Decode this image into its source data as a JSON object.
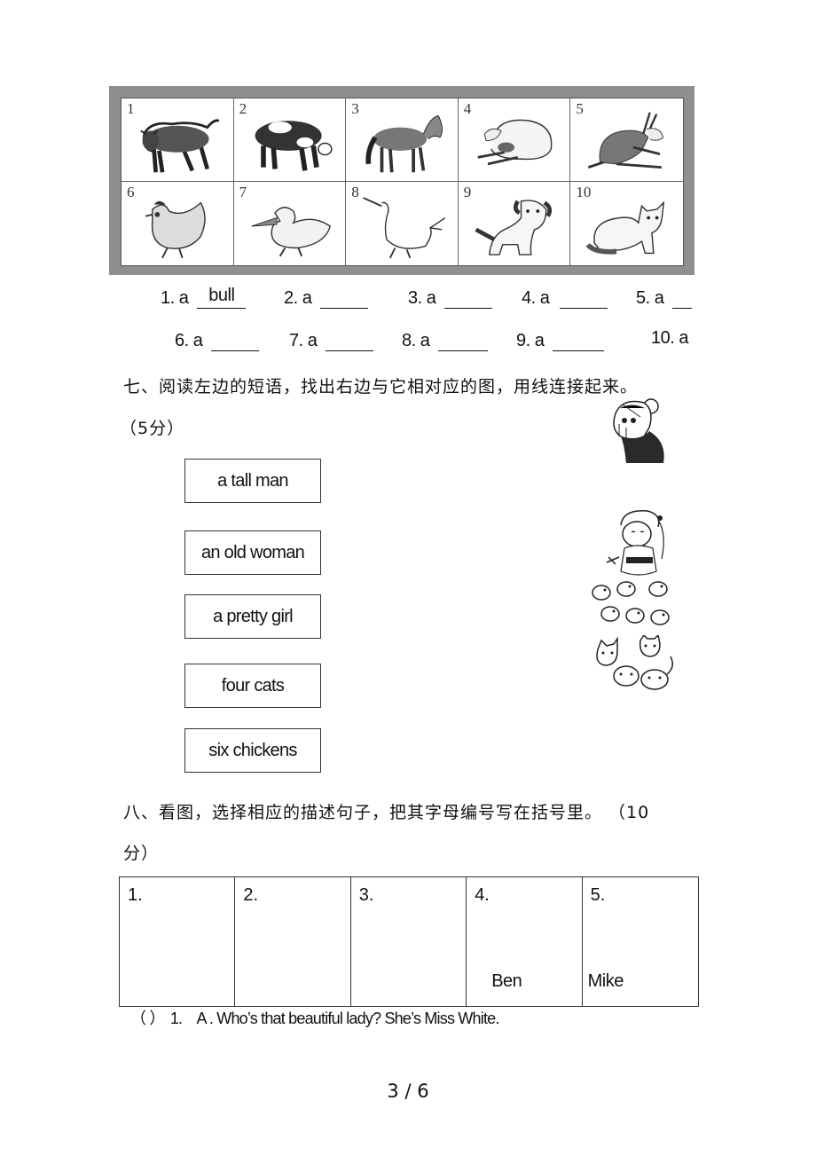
{
  "animal_panel": {
    "cells": [
      {
        "number": "1",
        "icon": "bull-icon"
      },
      {
        "number": "2",
        "icon": "cow-icon"
      },
      {
        "number": "3",
        "icon": "horse-icon"
      },
      {
        "number": "4",
        "icon": "sheep-icon"
      },
      {
        "number": "5",
        "icon": "goat-icon"
      },
      {
        "number": "6",
        "icon": "hen-icon"
      },
      {
        "number": "7",
        "icon": "duck-icon"
      },
      {
        "number": "8",
        "icon": "goose-icon"
      },
      {
        "number": "9",
        "icon": "dog-icon"
      },
      {
        "number": "10",
        "icon": "cat-icon"
      }
    ]
  },
  "answers": {
    "row1": [
      {
        "label": "1. a",
        "value": "bull"
      },
      {
        "label": "2. a",
        "value": ""
      },
      {
        "label": "3. a",
        "value": ""
      },
      {
        "label": "4. a",
        "value": ""
      },
      {
        "label": "5. a",
        "value": ""
      }
    ],
    "row2": [
      {
        "label": "6. a",
        "value": ""
      },
      {
        "label": "7. a",
        "value": ""
      },
      {
        "label": "8. a",
        "value": ""
      },
      {
        "label": "9. a",
        "value": ""
      },
      {
        "label": "10. a",
        "value": ""
      }
    ]
  },
  "section7": {
    "heading": "七、阅读左边的短语，找出右边与它相对应的图，用线连接起来。",
    "score": "（5分）",
    "phrases": [
      "a tall man",
      "an old woman",
      "a pretty girl",
      "four cats",
      "six chickens"
    ],
    "pictures": [
      "old-woman-icon",
      "girl-icon",
      "chickens-icon",
      "cats-icon"
    ]
  },
  "section8": {
    "heading_line1": "八、看图，选择相应的描述句子，把其字母编号写在括号里。 （10",
    "heading_line2": "分）",
    "cells": [
      {
        "number": "1.",
        "name": ""
      },
      {
        "number": "2.",
        "name": ""
      },
      {
        "number": "3.",
        "name": ""
      },
      {
        "number": "4.",
        "name": "Ben"
      },
      {
        "number": "5.",
        "name": "Mike"
      }
    ],
    "question": {
      "bracket": "（    ）",
      "number": "1.",
      "option": "A . Who’s that beautiful lady? She’s Miss White."
    }
  },
  "page_number": "3 / 6"
}
